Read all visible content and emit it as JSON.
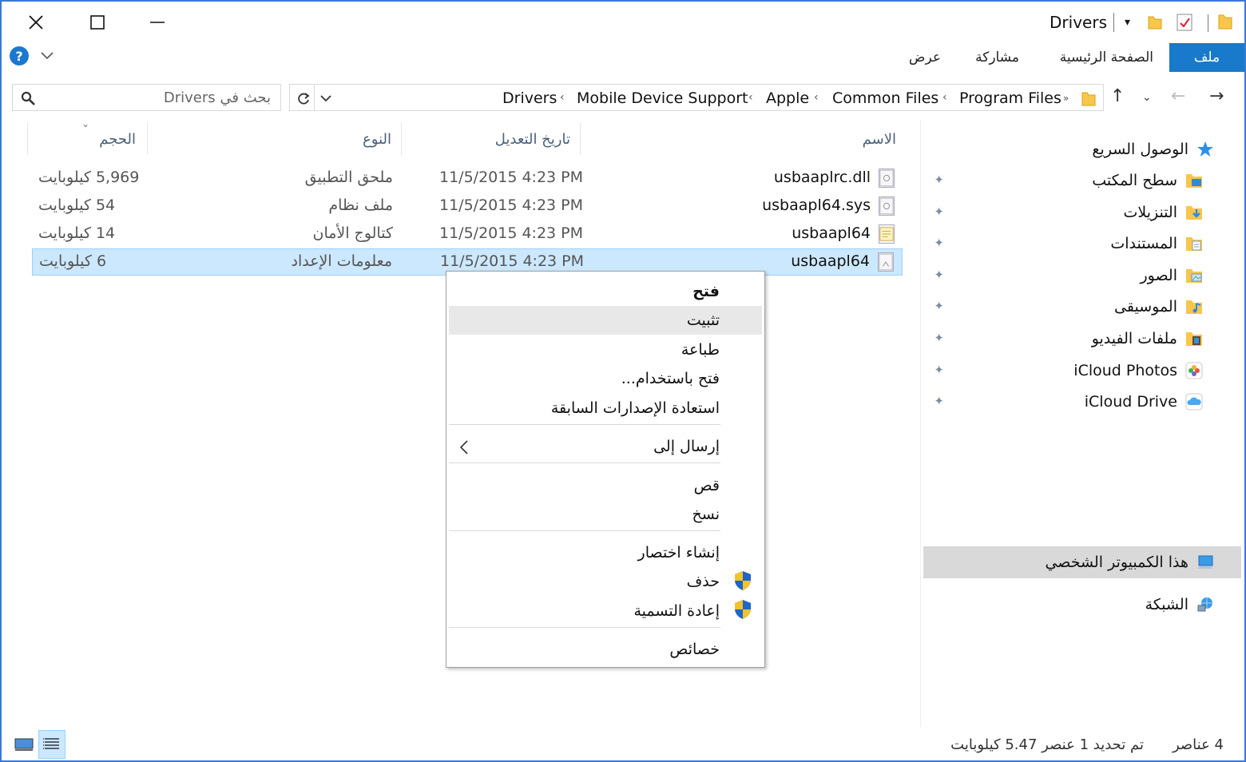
{
  "window": {
    "title": "Drivers"
  },
  "ribbon": {
    "tabs": [
      "ملف",
      "الصفحة الرئيسية",
      "مشاركة",
      "عرض"
    ]
  },
  "address": {
    "crumbs": [
      "Program Files",
      "Common Files",
      "Apple",
      "Mobile Device Support",
      "Drivers"
    ],
    "overflow": "»"
  },
  "search": {
    "placeholder": "بحث في Drivers"
  },
  "nav": {
    "quick_access": "الوصول السريع",
    "items": [
      {
        "label": "سطح المكتب",
        "icon": "desktop-folder-icon"
      },
      {
        "label": "التنزيلات",
        "icon": "downloads-folder-icon"
      },
      {
        "label": "المستندات",
        "icon": "documents-folder-icon"
      },
      {
        "label": "الصور",
        "icon": "pictures-folder-icon"
      },
      {
        "label": "الموسيقى",
        "icon": "music-folder-icon"
      },
      {
        "label": "ملفات الفيديو",
        "icon": "videos-folder-icon"
      },
      {
        "label": "iCloud Photos",
        "icon": "icloud-photos-icon"
      },
      {
        "label": "iCloud Drive",
        "icon": "icloud-drive-icon"
      }
    ],
    "this_pc": "هذا الكمبيوتر الشخصي",
    "network": "الشبكة"
  },
  "columns": {
    "name": "الاسم",
    "date": "تاريخ التعديل",
    "type": "النوع",
    "size": "الحجم"
  },
  "files": [
    {
      "name": "usbaaplrc.dll",
      "date": "11/5/2015 4:23 PM",
      "type": "ملحق التطبيق",
      "size": "5,969 كيلوبايت"
    },
    {
      "name": "usbaapl64.sys",
      "date": "11/5/2015 4:23 PM",
      "type": "ملف نظام",
      "size": "54 كيلوبايت"
    },
    {
      "name": "usbaapl64",
      "date": "11/5/2015 4:23 PM",
      "type": "كتالوج الأمان",
      "size": "14 كيلوبايت"
    },
    {
      "name": "usbaapl64",
      "date": "11/5/2015 4:23 PM",
      "type": "معلومات الإعداد",
      "size": "6 كيلوبايت"
    }
  ],
  "context_menu": {
    "open": "فتح",
    "install": "تثبيت",
    "print": "طباعة",
    "open_with": "فتح باستخدام...",
    "restore": "استعادة الإصدارات السابقة",
    "send_to": "إرسال إلى",
    "cut": "قص",
    "copy": "نسخ",
    "create_shortcut": "إنشاء اختصار",
    "delete": "حذف",
    "rename": "إعادة التسمية",
    "properties": "خصائص"
  },
  "status": {
    "count": "4 عناصر",
    "selection": "تم تحديد 1 عنصر 5.47 كيلوبايت"
  },
  "colors": {
    "accent": "#1979ca",
    "selection_bg": "#cce8ff",
    "border": "#3a78d4"
  }
}
